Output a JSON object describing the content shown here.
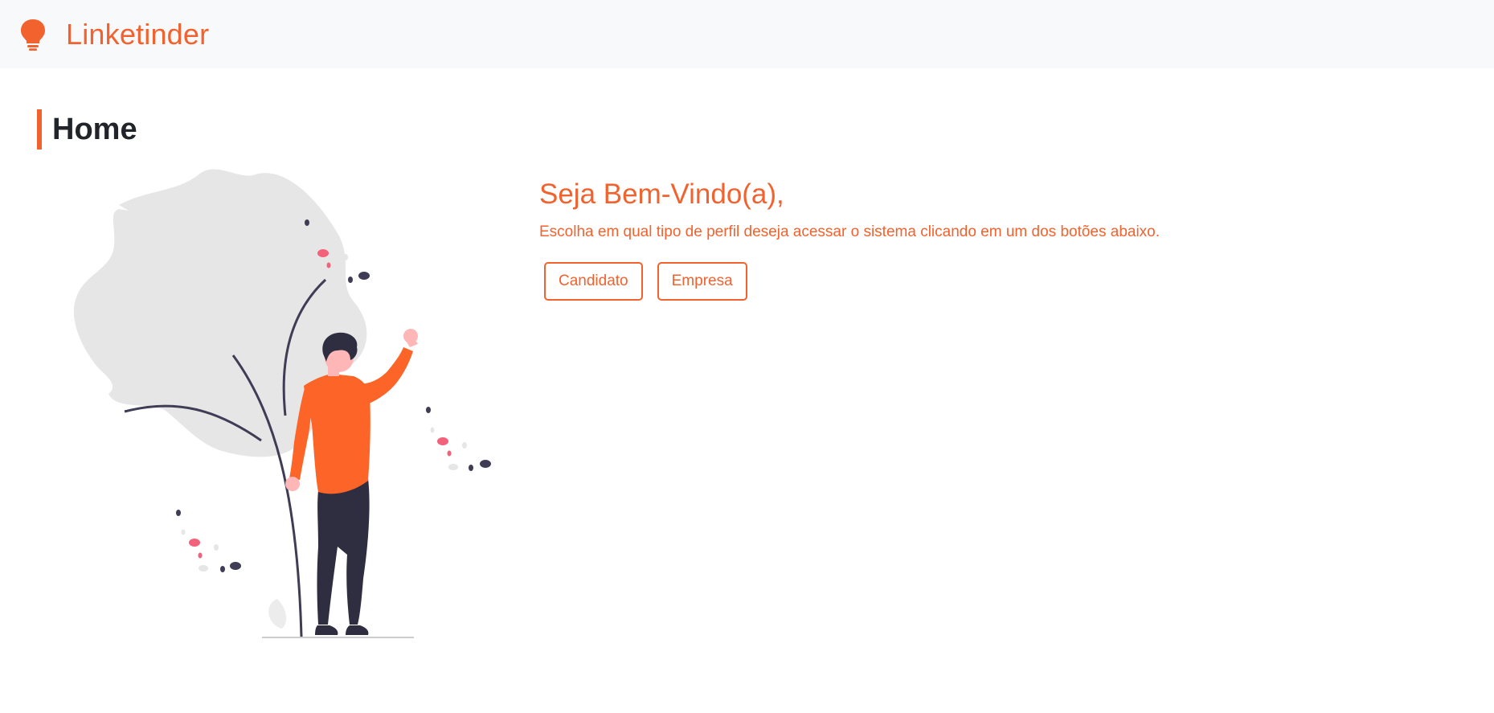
{
  "app": {
    "brand_name": "Linketinder",
    "brand_icon": "lightbulb-icon",
    "accent_color": "#f2622e"
  },
  "page": {
    "title": "Home"
  },
  "welcome": {
    "heading": "Seja Bem-Vindo(a),",
    "subtitle": "Escolha em qual tipo de perfil deseja acessar o sistema clicando em um dos botões abaixo.",
    "buttons": [
      {
        "label": "Candidato"
      },
      {
        "label": "Empresa"
      }
    ]
  },
  "illustration": {
    "icon": "person-waving-illustration",
    "colors": {
      "shirt": "#fc6428",
      "pants": "#2f2e41",
      "skin": "#ffb6b6",
      "leaf": "#e6e6e6",
      "accent_dots": "#f4617a"
    }
  }
}
